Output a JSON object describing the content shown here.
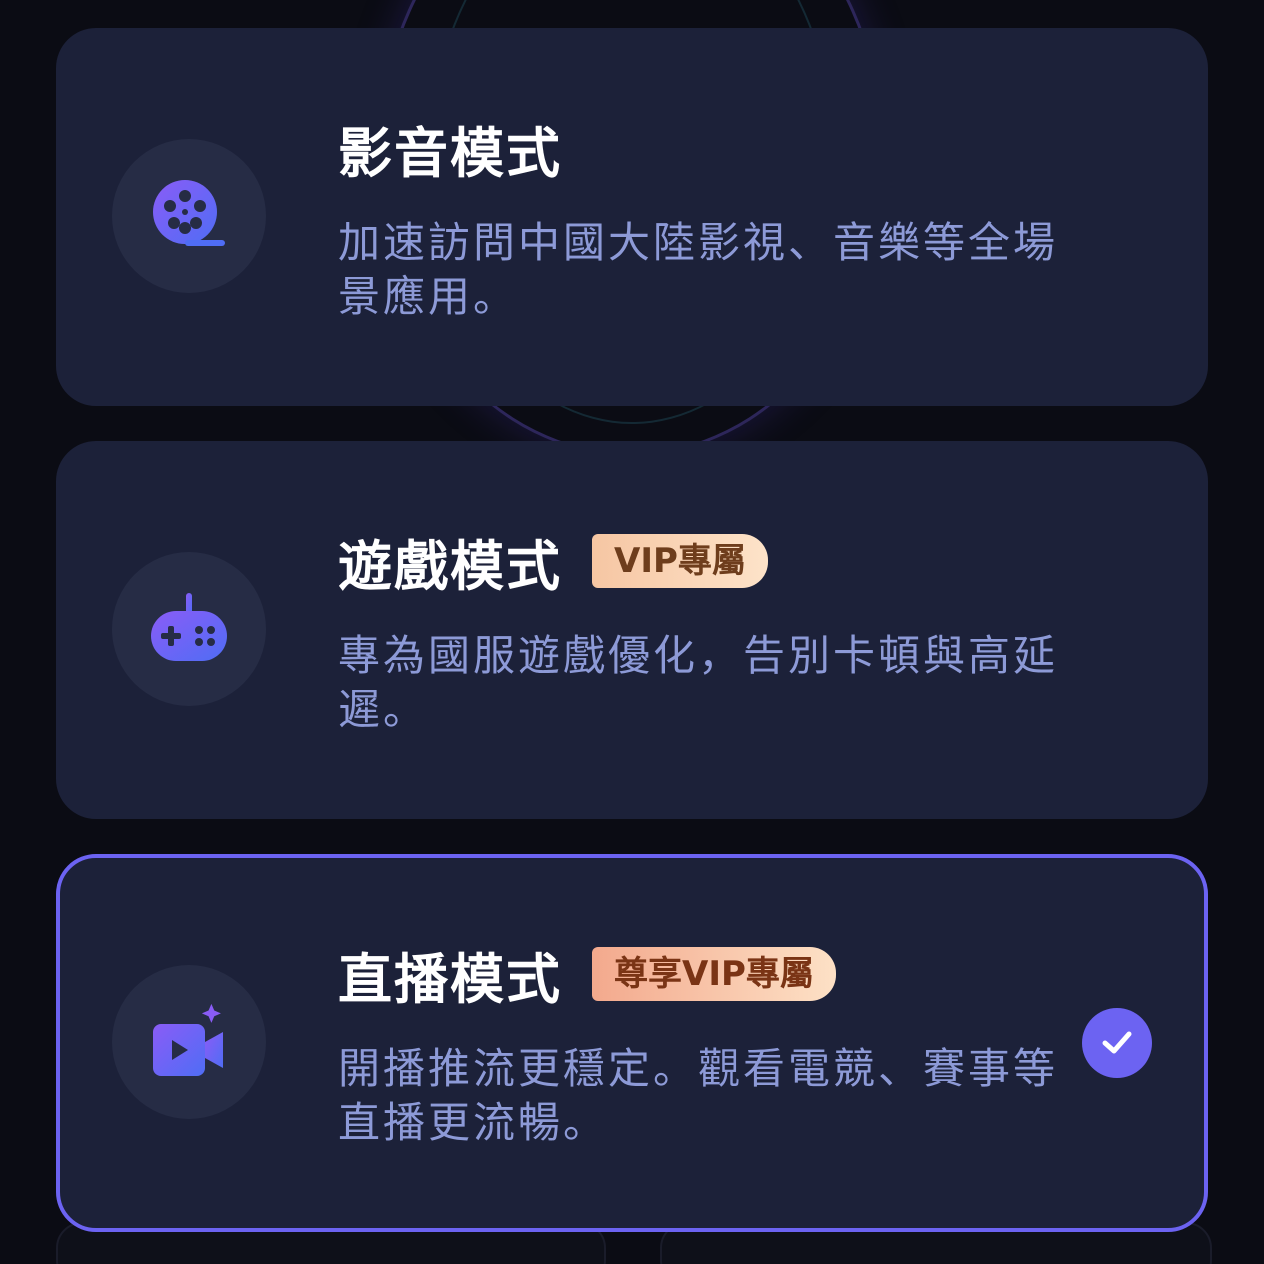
{
  "modes": [
    {
      "title": "影音模式",
      "badge": "",
      "description": "加速訪問中國大陸影視、音樂等全場景應用。",
      "icon": "film-reel-icon",
      "selected": false
    },
    {
      "title": "遊戲模式",
      "badge": "VIP專屬",
      "description": "專為國服遊戲優化，告別卡頓與高延遲。",
      "icon": "gamepad-icon",
      "selected": false
    },
    {
      "title": "直播模式",
      "badge": "尊享VIP專屬",
      "description": "開播推流更穩定。觀看電競、賽事等直播更流暢。",
      "icon": "video-camera-icon",
      "selected": true
    }
  ],
  "colors": {
    "card_background": "#1c2139",
    "icon_circle": "#262c45",
    "accent": "#6c63f2",
    "title_text": "#ffffff",
    "description_text": "#8d9ad7",
    "badge_gradient_start": "#f6c6a3",
    "badge_gradient_end": "#fde3c9",
    "badge_text": "#6e3d1c"
  }
}
